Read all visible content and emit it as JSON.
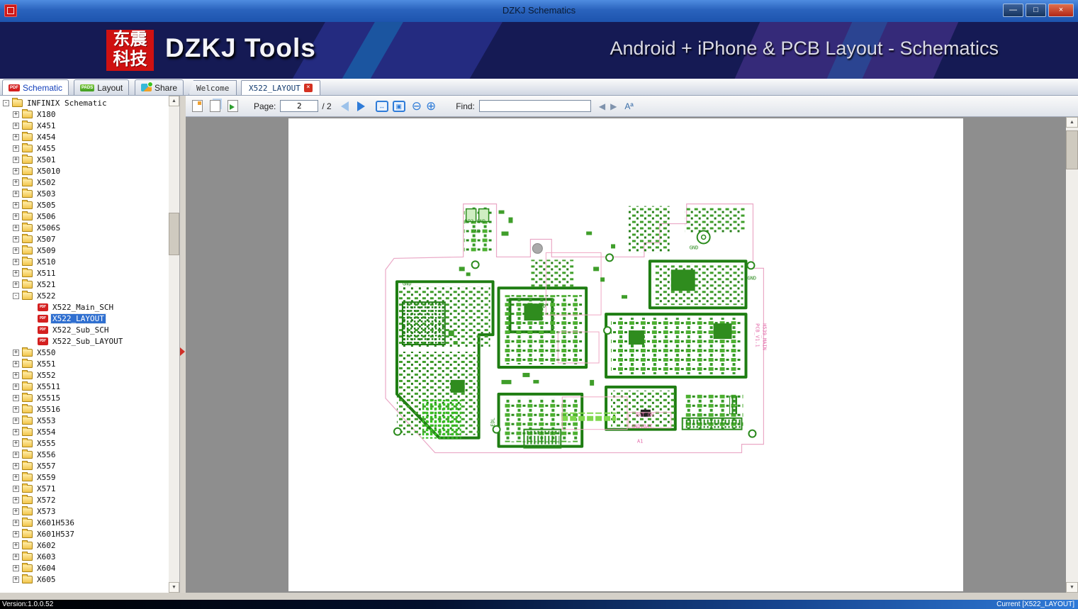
{
  "window": {
    "title": "DZKJ Schematics",
    "minimize_label": "—",
    "maximize_label": "□",
    "close_label": "×"
  },
  "banner": {
    "logo_line1": "东震",
    "logo_line2": "科技",
    "app_name": "DZKJ Tools",
    "tagline": "Android + iPhone & PCB Layout - Schematics"
  },
  "ribbon_tabs": [
    {
      "label": "Schematic"
    },
    {
      "label": "Layout"
    },
    {
      "label": "Share"
    }
  ],
  "doc_tabs": {
    "welcome": "Welcome",
    "active": "X522_LAYOUT"
  },
  "toolbar": {
    "page_label": "Page:",
    "page_value": "2",
    "page_total": "/ 2",
    "find_label": "Find:",
    "find_value": ""
  },
  "icons": {
    "pdf_badge": "PDF",
    "pads_badge": "PADS",
    "up_arrow": "▲",
    "down_arrow": "▼",
    "fit_width": "↔",
    "fit_page": "▣",
    "zoom_out": "⊖",
    "zoom_in": "⊕",
    "find_prev": "◀",
    "find_next": "▶",
    "match_case": "Aª",
    "close_tab": "×",
    "expand": "+",
    "collapse": "-"
  },
  "sidebar": {
    "root_label": "INFINIX Schematic",
    "items_before": [
      "X180",
      "X451",
      "X454",
      "X455",
      "X501",
      "X5010",
      "X502",
      "X503",
      "X505",
      "X506",
      "X506S",
      "X507",
      "X509",
      "X510",
      "X511",
      "X521"
    ],
    "expanded_folder": "X522",
    "expanded_children": [
      "X522_Main_SCH",
      "X522_LAYOUT",
      "X522_Sub_SCH",
      "X522_Sub_LAYOUT"
    ],
    "selected_child": "X522_LAYOUT",
    "items_after": [
      "X550",
      "X551",
      "X552",
      "X5511",
      "X5515",
      "X5516",
      "X553",
      "X554",
      "X555",
      "X556",
      "X557",
      "X559",
      "X571",
      "X572",
      "X573",
      "X601H536",
      "X601H537",
      "X602",
      "X603",
      "X604",
      "X605"
    ]
  },
  "pcb": {
    "labels": {
      "gnd": "GND",
      "dp3": "DP3 GND",
      "bat_on": "BAT_ON",
      "gndvbat": "GNDVBAT",
      "a1": "A1",
      "pcb_ver": "PCB_V1.1",
      "board_name": "H539_MAIN",
      "edl": "EDL"
    }
  },
  "status": {
    "left": "Version:1.0.0.52",
    "right": "Current [X522_LAYOUT]"
  }
}
